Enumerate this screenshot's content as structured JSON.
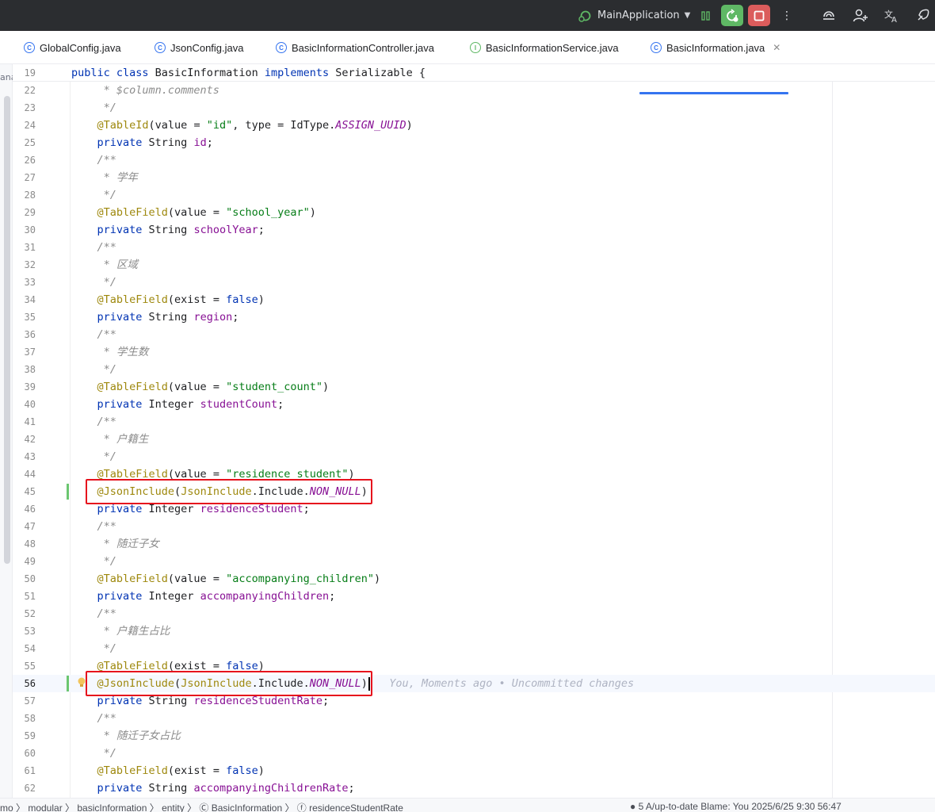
{
  "titlebar": {
    "run_config": "MainApplication",
    "icons": [
      "run-config-icon",
      "debug-icon",
      "rerun-icon",
      "stop-icon",
      "more-icon",
      "ai-icon",
      "add-user-icon",
      "translate-icon",
      "deploy-icon"
    ],
    "colors": {
      "rerun_bg": "#5fb865",
      "stop_bg": "#db5c5c"
    }
  },
  "tabs": [
    {
      "label": "GlobalConfig.java",
      "icon": "class-icon"
    },
    {
      "label": "JsonConfig.java",
      "icon": "class-icon"
    },
    {
      "label": "BasicInformationController.java",
      "icon": "class-icon"
    },
    {
      "label": "BasicInformationService.java",
      "icon": "interface-icon"
    },
    {
      "label": "BasicInformation.java",
      "icon": "class-icon",
      "active": true
    }
  ],
  "left_strip_text": "ana",
  "sticky_line": {
    "num": "19",
    "tokens": [
      [
        "kw",
        "public class "
      ],
      [
        "ref",
        "BasicInformation "
      ],
      [
        "kw",
        "implements "
      ],
      [
        "ref",
        "Serializable {"
      ]
    ]
  },
  "lines": [
    {
      "num": "22",
      "tokens": [
        [
          "cmt",
          "     * $column.comments"
        ]
      ]
    },
    {
      "num": "23",
      "tokens": [
        [
          "cmt",
          "     */"
        ]
      ]
    },
    {
      "num": "24",
      "tokens": [
        [
          "ann",
          "    @TableId"
        ],
        [
          "ref",
          "(value = "
        ],
        [
          "str",
          "\"id\""
        ],
        [
          "ref",
          ", type = IdType."
        ],
        [
          "cst",
          "ASSIGN_UUID"
        ],
        [
          "ref",
          ")"
        ]
      ]
    },
    {
      "num": "25",
      "tokens": [
        [
          "kw",
          "    private "
        ],
        [
          "ref",
          "String "
        ],
        [
          "fld",
          "id"
        ],
        [
          "ref",
          ";"
        ]
      ]
    },
    {
      "num": "26",
      "tokens": [
        [
          "cmt",
          "    /**"
        ]
      ]
    },
    {
      "num": "27",
      "tokens": [
        [
          "cmt",
          "     * 学年"
        ]
      ]
    },
    {
      "num": "28",
      "tokens": [
        [
          "cmt",
          "     */"
        ]
      ]
    },
    {
      "num": "29",
      "tokens": [
        [
          "ann",
          "    @TableField"
        ],
        [
          "ref",
          "(value = "
        ],
        [
          "str",
          "\"school_year\""
        ],
        [
          "ref",
          ")"
        ]
      ]
    },
    {
      "num": "30",
      "tokens": [
        [
          "kw",
          "    private "
        ],
        [
          "ref",
          "String "
        ],
        [
          "fld",
          "schoolYear"
        ],
        [
          "ref",
          ";"
        ]
      ]
    },
    {
      "num": "31",
      "tokens": [
        [
          "cmt",
          "    /**"
        ]
      ]
    },
    {
      "num": "32",
      "tokens": [
        [
          "cmt",
          "     * 区域"
        ]
      ]
    },
    {
      "num": "33",
      "tokens": [
        [
          "cmt",
          "     */"
        ]
      ]
    },
    {
      "num": "34",
      "tokens": [
        [
          "ann",
          "    @TableField"
        ],
        [
          "ref",
          "(exist = "
        ],
        [
          "kw",
          "false"
        ],
        [
          "ref",
          ")"
        ]
      ]
    },
    {
      "num": "35",
      "tokens": [
        [
          "kw",
          "    private "
        ],
        [
          "ref",
          "String "
        ],
        [
          "fld",
          "region"
        ],
        [
          "ref",
          ";"
        ]
      ]
    },
    {
      "num": "36",
      "tokens": [
        [
          "cmt",
          "    /**"
        ]
      ]
    },
    {
      "num": "37",
      "tokens": [
        [
          "cmt",
          "     * 学生数"
        ]
      ]
    },
    {
      "num": "38",
      "tokens": [
        [
          "cmt",
          "     */"
        ]
      ]
    },
    {
      "num": "39",
      "tokens": [
        [
          "ann",
          "    @TableField"
        ],
        [
          "ref",
          "(value = "
        ],
        [
          "str",
          "\"student_count\""
        ],
        [
          "ref",
          ")"
        ]
      ]
    },
    {
      "num": "40",
      "tokens": [
        [
          "kw",
          "    private "
        ],
        [
          "ref",
          "Integer "
        ],
        [
          "fld",
          "studentCount"
        ],
        [
          "ref",
          ";"
        ]
      ]
    },
    {
      "num": "41",
      "tokens": [
        [
          "cmt",
          "    /**"
        ]
      ]
    },
    {
      "num": "42",
      "tokens": [
        [
          "cmt",
          "     * 户籍生"
        ]
      ]
    },
    {
      "num": "43",
      "tokens": [
        [
          "cmt",
          "     */"
        ]
      ]
    },
    {
      "num": "44",
      "tokens": [
        [
          "ann",
          "    @TableField"
        ],
        [
          "ref",
          "(value = "
        ],
        [
          "str",
          "\"residence_student\""
        ],
        [
          "ref",
          ")"
        ]
      ]
    },
    {
      "num": "45",
      "tokens": [
        [
          "ann",
          "    @JsonInclude"
        ],
        [
          "ref",
          "("
        ],
        [
          "ann",
          "JsonInclude"
        ],
        [
          "ref",
          ".Include."
        ],
        [
          "cst",
          "NON_NULL"
        ],
        [
          "ref",
          ")"
        ]
      ],
      "modified": true,
      "boxed": true
    },
    {
      "num": "46",
      "tokens": [
        [
          "kw",
          "    private "
        ],
        [
          "ref",
          "Integer "
        ],
        [
          "fld",
          "residenceStudent"
        ],
        [
          "ref",
          ";"
        ]
      ]
    },
    {
      "num": "47",
      "tokens": [
        [
          "cmt",
          "    /**"
        ]
      ]
    },
    {
      "num": "48",
      "tokens": [
        [
          "cmt",
          "     * 随迁子女"
        ]
      ]
    },
    {
      "num": "49",
      "tokens": [
        [
          "cmt",
          "     */"
        ]
      ]
    },
    {
      "num": "50",
      "tokens": [
        [
          "ann",
          "    @TableField"
        ],
        [
          "ref",
          "(value = "
        ],
        [
          "str",
          "\"accompanying_children\""
        ],
        [
          "ref",
          ")"
        ]
      ]
    },
    {
      "num": "51",
      "tokens": [
        [
          "kw",
          "    private "
        ],
        [
          "ref",
          "Integer "
        ],
        [
          "fld",
          "accompanyingChildren"
        ],
        [
          "ref",
          ";"
        ]
      ]
    },
    {
      "num": "52",
      "tokens": [
        [
          "cmt",
          "    /**"
        ]
      ]
    },
    {
      "num": "53",
      "tokens": [
        [
          "cmt",
          "     * 户籍生占比"
        ]
      ]
    },
    {
      "num": "54",
      "tokens": [
        [
          "cmt",
          "     */"
        ]
      ]
    },
    {
      "num": "55",
      "tokens": [
        [
          "ann",
          "    @TableField"
        ],
        [
          "ref",
          "(exist = "
        ],
        [
          "kw",
          "false"
        ],
        [
          "ref",
          ")"
        ]
      ]
    },
    {
      "num": "56",
      "tokens": [
        [
          "ann",
          "    @JsonInclude"
        ],
        [
          "ref",
          "("
        ],
        [
          "ann",
          "JsonInclude"
        ],
        [
          "ref",
          ".Include."
        ],
        [
          "cst",
          "NON_NULL"
        ],
        [
          "ref",
          ")"
        ]
      ],
      "modified": true,
      "boxed": true,
      "current": true,
      "blame": "   You, Moments ago • Uncommitted changes"
    },
    {
      "num": "57",
      "tokens": [
        [
          "kw",
          "    private "
        ],
        [
          "ref",
          "String "
        ],
        [
          "fld",
          "residenceStudentRate"
        ],
        [
          "ref",
          ";"
        ]
      ]
    },
    {
      "num": "58",
      "tokens": [
        [
          "cmt",
          "    /**"
        ]
      ]
    },
    {
      "num": "59",
      "tokens": [
        [
          "cmt",
          "     * 随迁子女占比"
        ]
      ]
    },
    {
      "num": "60",
      "tokens": [
        [
          "cmt",
          "     */"
        ]
      ]
    },
    {
      "num": "61",
      "tokens": [
        [
          "ann",
          "    @TableField"
        ],
        [
          "ref",
          "(exist = "
        ],
        [
          "kw",
          "false"
        ],
        [
          "ref",
          ")"
        ]
      ]
    },
    {
      "num": "62",
      "tokens": [
        [
          "kw",
          "    private "
        ],
        [
          "ref",
          "String "
        ],
        [
          "fld",
          "accompanyingChildrenRate"
        ],
        [
          "ref",
          ";"
        ]
      ]
    }
  ],
  "status": {
    "breadcrumb": "mo 〉 modular 〉 basicInformation 〉 entity 〉 Ⓒ BasicInformation 〉 ⓕ residenceStudentRate",
    "right": "● 5 A/up-to-date   Blame: You 2025/6/25 9:30    56:47"
  }
}
